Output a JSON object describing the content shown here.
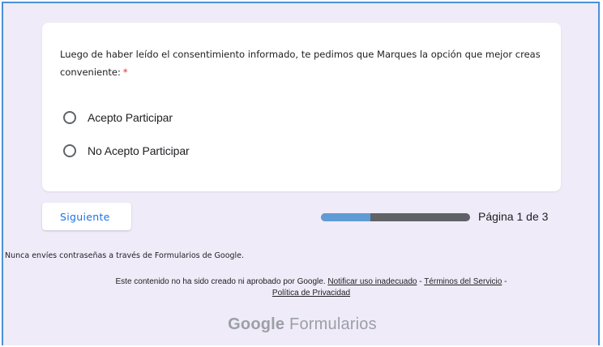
{
  "question": {
    "text": "Luego de haber leído el consentimiento informado, te pedimos que Marques la opción que mejor creas conveniente:",
    "required_marker": "*"
  },
  "options": [
    {
      "label": "Acepto Participar",
      "selected": false
    },
    {
      "label": "No Acepto Participar",
      "selected": false
    }
  ],
  "navigation": {
    "next_label": "Siguiente",
    "progress_fraction": 0.33,
    "page_indicator": "Página 1 de 3"
  },
  "footer": {
    "password_warning": "Nunca envíes contraseñas a través de Formularios de Google.",
    "disclaimer_prefix": "Este contenido no ha sido creado ni aprobado por Google.",
    "report_link": "Notificar uso inadecuado",
    "separator": "-",
    "terms_link": "Términos del Servicio",
    "privacy_link": "Política de Privacidad",
    "brand_google": "Google",
    "brand_product": "Formularios"
  },
  "colors": {
    "accent": "#1a73e8",
    "required": "#d93025",
    "background": "#f0ebf8",
    "progress_fill": "#5f9bd5",
    "progress_track": "#5f6368",
    "frame_border": "#4a90d9"
  }
}
